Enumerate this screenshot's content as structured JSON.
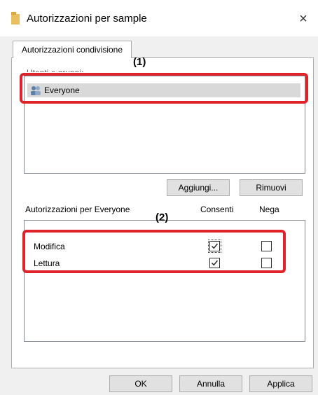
{
  "window": {
    "title": "Autorizzazioni per sample",
    "close_label": "×",
    "folder_icon": "folder-icon"
  },
  "tab": {
    "label": "Autorizzazioni condivisione"
  },
  "groups": {
    "label": "Utenti e gruppi:",
    "items": [
      {
        "name": "Everyone",
        "icon": "users-icon"
      }
    ]
  },
  "buttons": {
    "add": "Aggiungi...",
    "remove": "Rimuovi",
    "ok": "OK",
    "cancel": "Annulla",
    "apply": "Applica"
  },
  "permissions": {
    "header": "Autorizzazioni per Everyone",
    "allow_header": "Consenti",
    "deny_header": "Nega",
    "rows": [
      {
        "label": "Modifica",
        "allow": true,
        "deny": false
      },
      {
        "label": "Lettura",
        "allow": true,
        "deny": false
      }
    ]
  },
  "callouts": {
    "one": "(1)",
    "two": "(2)"
  },
  "colors": {
    "highlight": "#e0222a",
    "selection": "#d9d9d9"
  }
}
